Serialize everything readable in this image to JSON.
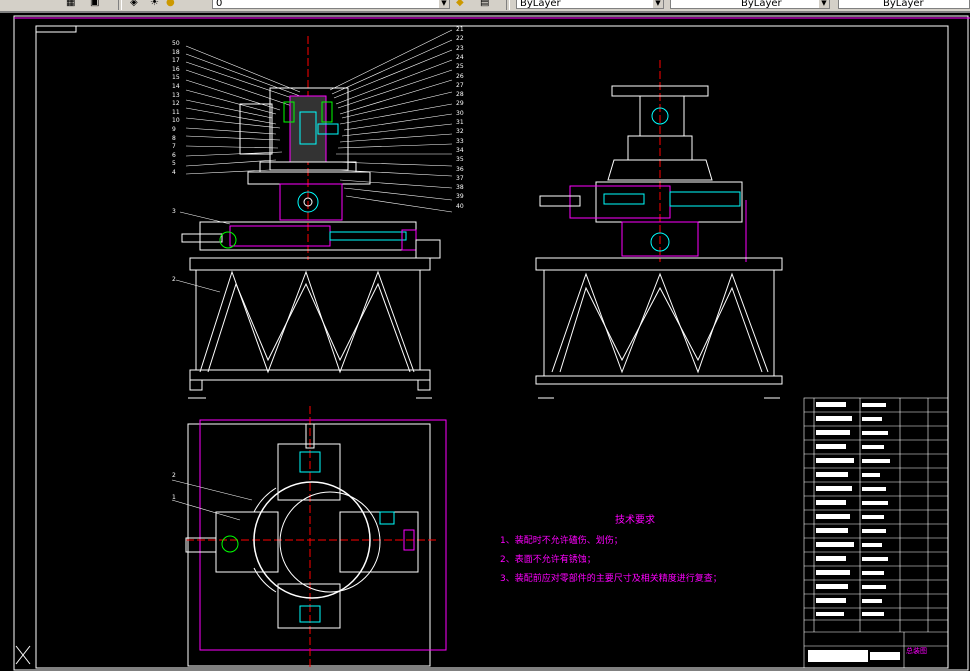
{
  "toolbar": {
    "layer_combo": "0",
    "color_combo": "ByLayer",
    "linetype_combo": "ByLayer",
    "lineweight_combo": "ByLayer"
  },
  "drawing": {
    "tech_title": "技术要求",
    "requirements": [
      "1、装配时不允许磕伤、划伤；",
      "2、表面不允许有锈蚀；",
      "3、装配前应对零部件的主要尺寸及相关精度进行复查；"
    ],
    "title_block_name": "总装图",
    "callouts_left": [
      "50",
      "18",
      "17",
      "16",
      "15",
      "14",
      "13",
      "12",
      "11",
      "10",
      "9",
      "8",
      "7",
      "6",
      "5",
      "4",
      "3",
      "2",
      "1"
    ],
    "callouts_right": [
      "21",
      "22",
      "23",
      "24",
      "25",
      "26",
      "27",
      "28",
      "29",
      "30",
      "31",
      "32",
      "33",
      "34",
      "35",
      "36",
      "37",
      "38",
      "39",
      "40"
    ]
  },
  "colors": {
    "frame": "#ffffff",
    "accent": "#ff00ff",
    "centerline": "#ff0000",
    "part": "#00ffff",
    "bearing": "#00ff00"
  }
}
